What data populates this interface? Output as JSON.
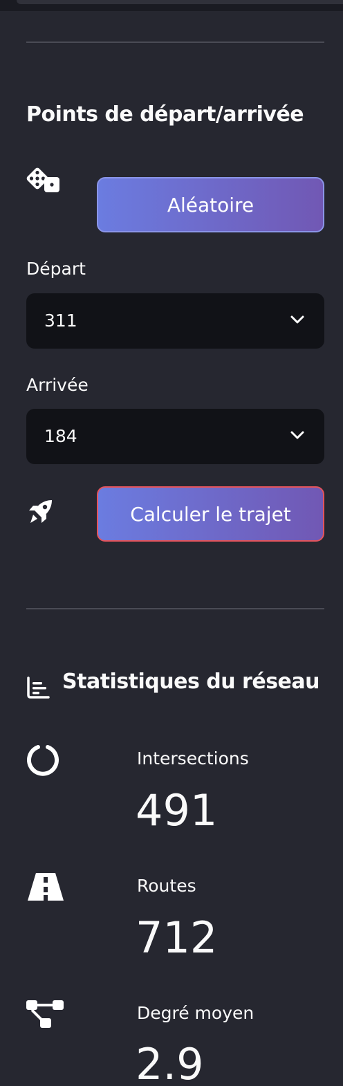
{
  "endpoints": {
    "title": "Points de départ/arrivée",
    "random_label": "Aléatoire",
    "departure": {
      "label": "Départ",
      "value": "311"
    },
    "arrival": {
      "label": "Arrivée",
      "value": "184"
    },
    "compute_label": "Calculer le trajet"
  },
  "stats": {
    "title": "Statistiques du réseau",
    "items": [
      {
        "label": "Intersections",
        "value": "491",
        "icon": "circle-notch-icon"
      },
      {
        "label": "Routes",
        "value": "712",
        "icon": "road-icon"
      },
      {
        "label": "Degré moyen",
        "value": "2.9",
        "icon": "network-icon"
      }
    ]
  },
  "colors": {
    "background": "#262730",
    "button_gradient_start": "#6b7ce0",
    "button_gradient_end": "#7158b4",
    "select_background": "#111217",
    "compute_border": "#e4545c"
  }
}
